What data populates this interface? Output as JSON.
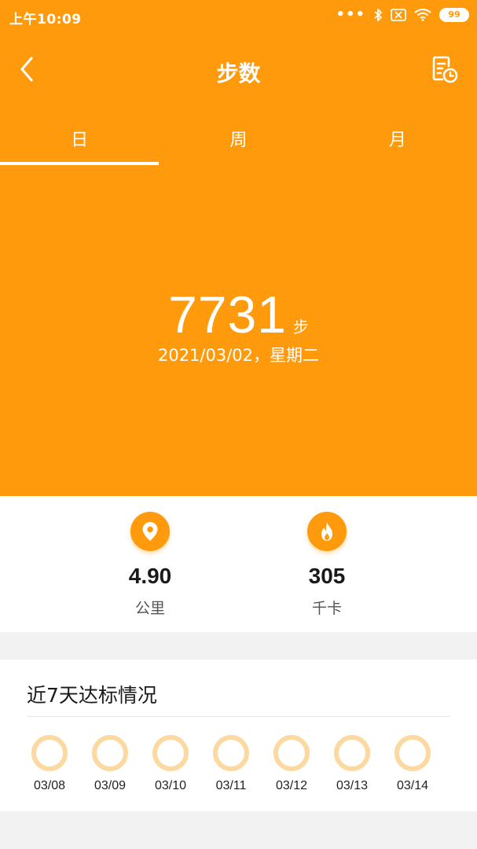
{
  "status_bar": {
    "time": "上午10:09",
    "battery": "99",
    "icons": [
      "more-dots-icon",
      "bluetooth-icon",
      "sim-off-icon",
      "wifi-icon",
      "battery-icon"
    ]
  },
  "header": {
    "title": "步数",
    "back_icon": "back-chevron-icon",
    "history_icon": "history-record-icon"
  },
  "tabs": [
    {
      "label": "日",
      "active": true
    },
    {
      "label": "周",
      "active": false
    },
    {
      "label": "月",
      "active": false
    }
  ],
  "hero": {
    "steps": "7731",
    "unit": "步",
    "date": "2021/03/02，星期二"
  },
  "stats": [
    {
      "icon": "location-pin-icon",
      "value": "4.90",
      "unit": "公里"
    },
    {
      "icon": "flame-icon",
      "value": "305",
      "unit": "千卡"
    }
  ],
  "week": {
    "title": "近7天达标情况",
    "days": [
      {
        "date": "03/08",
        "progress": 0
      },
      {
        "date": "03/09",
        "progress": 0
      },
      {
        "date": "03/10",
        "progress": 0
      },
      {
        "date": "03/11",
        "progress": 0
      },
      {
        "date": "03/12",
        "progress": 0
      },
      {
        "date": "03/13",
        "progress": 0
      },
      {
        "date": "03/14",
        "progress": 0
      }
    ]
  },
  "colors": {
    "accent": "#FF9A0D",
    "ring": "#FCD9A0",
    "background": "#F2F2F2"
  }
}
